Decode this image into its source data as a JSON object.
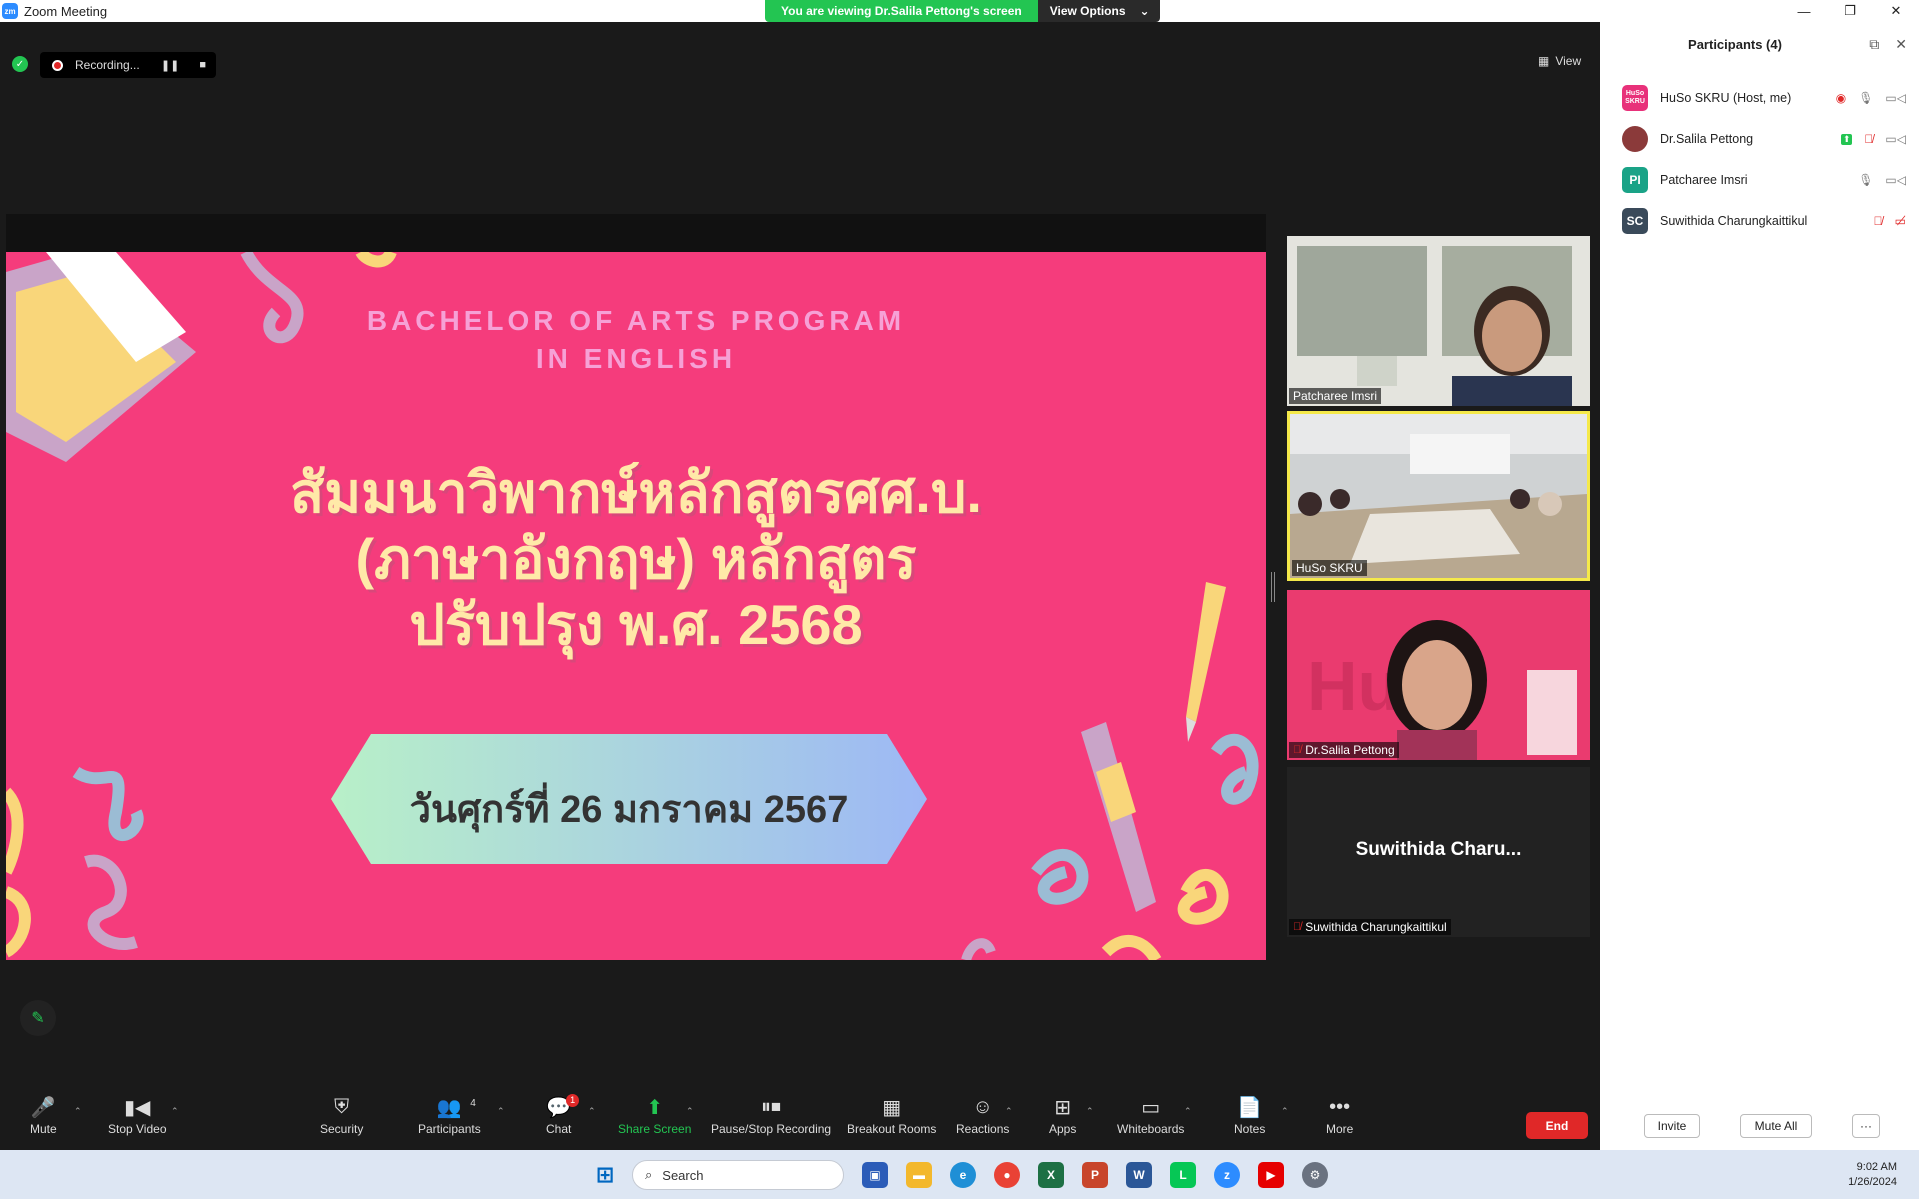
{
  "window": {
    "title": "Zoom Meeting"
  },
  "banner": {
    "viewing": "You are viewing Dr.Salila Pettong's screen",
    "view_options": "View Options"
  },
  "recording": {
    "label": "Recording..."
  },
  "view_button": "View",
  "slide": {
    "heading_line1": "BACHELOR OF ARTS PROGRAM",
    "heading_line2": "IN ENGLISH",
    "title_line1": "สัมมนาวิพากษ์หลักสูตรศศ.บ.",
    "title_line2": "(ภาษาอังกฤษ) หลักสูตร",
    "title_line3": "ปรับปรุง พ.ศ. 2568",
    "date": "วันศุกร์ที่ 26 มกราคม 2567"
  },
  "tiles": [
    {
      "name": "Patcharee Imsri"
    },
    {
      "name": "HuSo SKRU"
    },
    {
      "name": "Dr.Salila Pettong"
    },
    {
      "name": "Suwithida Charungkaittikul",
      "big_name": "Suwithida  Charu..."
    }
  ],
  "toolbar": {
    "mute": "Mute",
    "stop_video": "Stop Video",
    "security": "Security",
    "participants": "Participants",
    "participants_count": "4",
    "chat": "Chat",
    "chat_badge": "1",
    "share_screen": "Share Screen",
    "pause_recording": "Pause/Stop Recording",
    "breakout": "Breakout Rooms",
    "reactions": "Reactions",
    "apps": "Apps",
    "whiteboards": "Whiteboards",
    "notes": "Notes",
    "more": "More",
    "end": "End"
  },
  "panel": {
    "title": "Participants (4)",
    "participants": [
      {
        "name": "HuSo SKRU (Host, me)",
        "avatar": "HuSo SKRU",
        "color": "#e8317a"
      },
      {
        "name": "Dr.Salila Pettong",
        "avatar": "",
        "color": "#8b3a3a"
      },
      {
        "name": "Patcharee Imsri",
        "avatar": "PI",
        "color": "#1aa387"
      },
      {
        "name": "Suwithida Charungkaittikul",
        "avatar": "SC",
        "color": "#3a4a5a"
      }
    ],
    "invite": "Invite",
    "mute_all": "Mute All",
    "more": "···"
  },
  "taskbar": {
    "search": "Search",
    "time": "9:02 AM",
    "date": "1/26/2024"
  }
}
